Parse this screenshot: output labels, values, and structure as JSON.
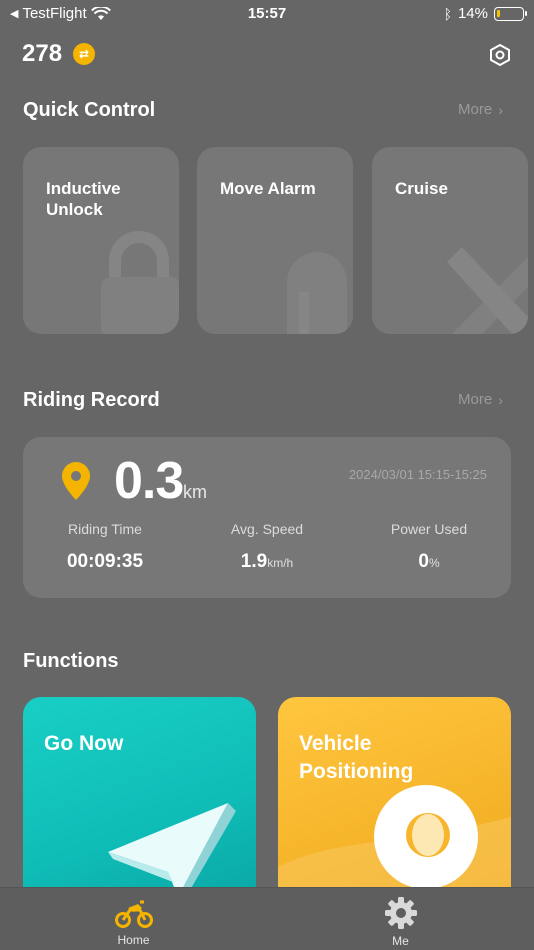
{
  "status_bar": {
    "back_app": "TestFlight",
    "time": "15:57",
    "battery_percent": "14%",
    "battery_level": 0.14
  },
  "header": {
    "count": "278",
    "coin_symbol": "⇄"
  },
  "quick_control": {
    "title": "Quick Control",
    "more": "More",
    "items": [
      {
        "label": "Inductive Unlock",
        "icon": "lock-icon"
      },
      {
        "label": "Move Alarm",
        "icon": "bell-icon"
      },
      {
        "label": "Cruise",
        "icon": "cruise-icon"
      }
    ]
  },
  "riding_record": {
    "title": "Riding Record",
    "more": "More",
    "distance": "0.3",
    "distance_unit": "km",
    "date_range": "2024/03/01 15:15-15:25",
    "stats": [
      {
        "label": "Riding Time",
        "value": "00:09:35",
        "unit": ""
      },
      {
        "label": "Avg. Speed",
        "value": "1.9",
        "unit": "km/h"
      },
      {
        "label": "Power Used",
        "value": "0",
        "unit": "%"
      }
    ]
  },
  "functions": {
    "title": "Functions",
    "items": [
      {
        "label": "Go Now",
        "color": "#14c8c0",
        "icon": "navigation-arrow-icon"
      },
      {
        "label": "Vehicle Positioning",
        "color": "#f8b72d",
        "icon": "location-pin-icon"
      }
    ]
  },
  "tab_bar": {
    "tabs": [
      {
        "label": "Home",
        "icon": "motorbike-icon",
        "active": true,
        "color": "#f5b400"
      },
      {
        "label": "Me",
        "icon": "gear-icon",
        "active": false
      }
    ]
  }
}
